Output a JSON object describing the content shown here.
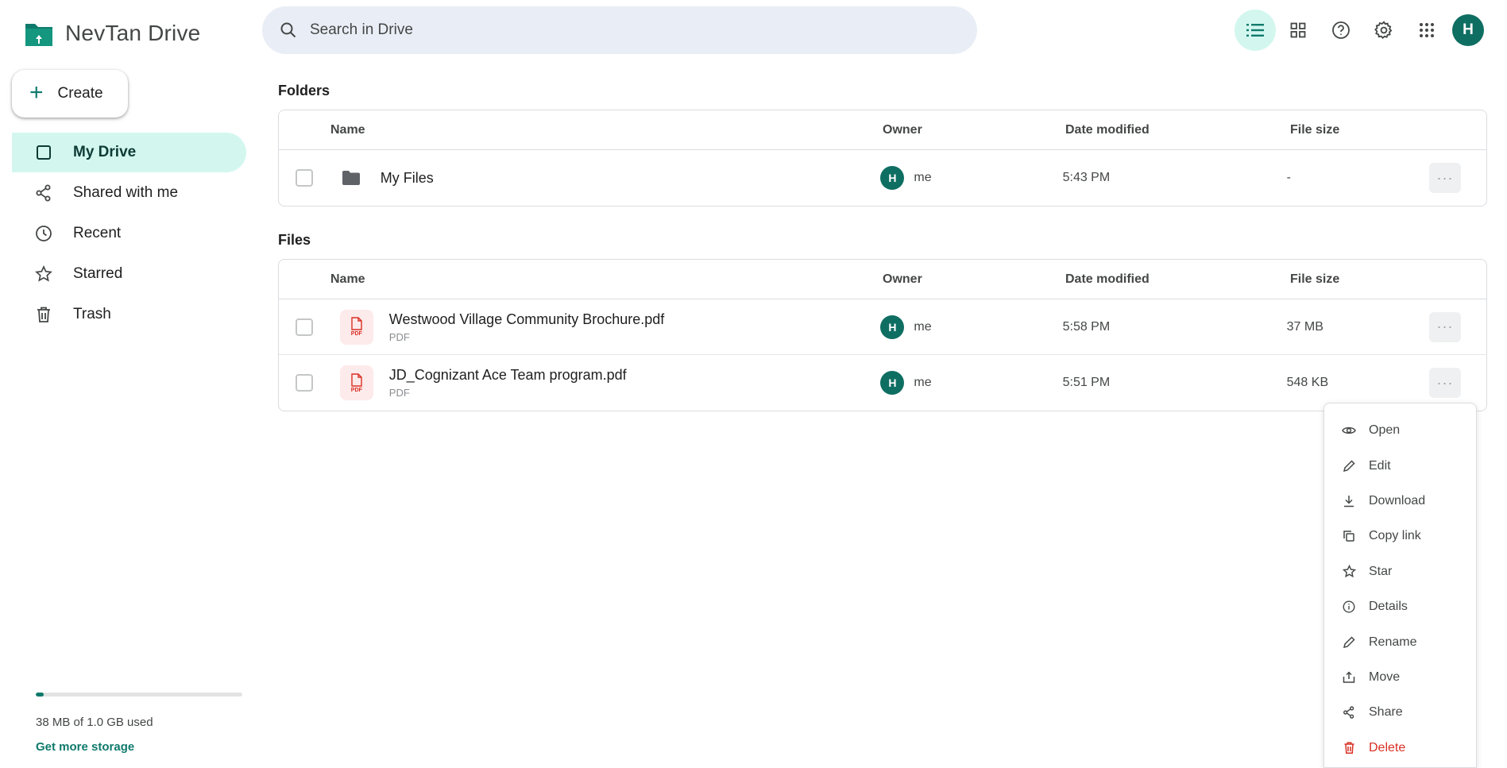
{
  "app": {
    "title": "NevTan Drive"
  },
  "sidebar": {
    "create_label": "Create",
    "items": [
      {
        "label": "My Drive",
        "icon": "my-drive-icon",
        "active": true
      },
      {
        "label": "Shared with me",
        "icon": "share-icon",
        "active": false
      },
      {
        "label": "Recent",
        "icon": "clock-icon",
        "active": false
      },
      {
        "label": "Starred",
        "icon": "star-icon",
        "active": false
      },
      {
        "label": "Trash",
        "icon": "trash-icon",
        "active": false
      }
    ],
    "storage": {
      "used_text": "38 MB of 1.0 GB used",
      "used_fraction": 0.038,
      "more_link": "Get more storage"
    }
  },
  "search": {
    "placeholder": "Search in Drive"
  },
  "toolbar": {
    "avatar_initial": "H"
  },
  "folders": {
    "title": "Folders",
    "columns": [
      "Name",
      "Owner",
      "Date modified",
      "File size"
    ],
    "rows": [
      {
        "name": "My Files",
        "owner_initial": "H",
        "owner": "me",
        "date": "5:43 PM",
        "size": "-"
      }
    ]
  },
  "files": {
    "title": "Files",
    "columns": [
      "Name",
      "Owner",
      "Date modified",
      "File size"
    ],
    "rows": [
      {
        "name": "Westwood Village Community Brochure.pdf",
        "type": "PDF",
        "badge": "PDF",
        "owner_initial": "H",
        "owner": "me",
        "date": "5:58 PM",
        "size": "37 MB"
      },
      {
        "name": "JD_Cognizant Ace Team program.pdf",
        "type": "PDF",
        "badge": "PDF",
        "owner_initial": "H",
        "owner": "me",
        "date": "5:51 PM",
        "size": "548 KB"
      }
    ]
  },
  "more_label": "···",
  "context_menu": {
    "items": [
      {
        "label": "Open",
        "icon": "eye-icon"
      },
      {
        "label": "Edit",
        "icon": "pencil-icon"
      },
      {
        "label": "Download",
        "icon": "download-icon"
      },
      {
        "label": "Copy link",
        "icon": "copy-icon"
      },
      {
        "label": "Star",
        "icon": "star-icon"
      },
      {
        "label": "Details",
        "icon": "info-icon"
      },
      {
        "label": "Rename",
        "icon": "pencil-icon"
      },
      {
        "label": "Move",
        "icon": "move-icon"
      },
      {
        "label": "Share",
        "icon": "share-icon"
      },
      {
        "label": "Delete",
        "icon": "trash-icon",
        "danger": true
      }
    ]
  },
  "colors": {
    "accent": "#0f7a6c",
    "active_bg": "#d3f7ef",
    "search_bg": "#e9eef6",
    "danger": "#d93025"
  }
}
